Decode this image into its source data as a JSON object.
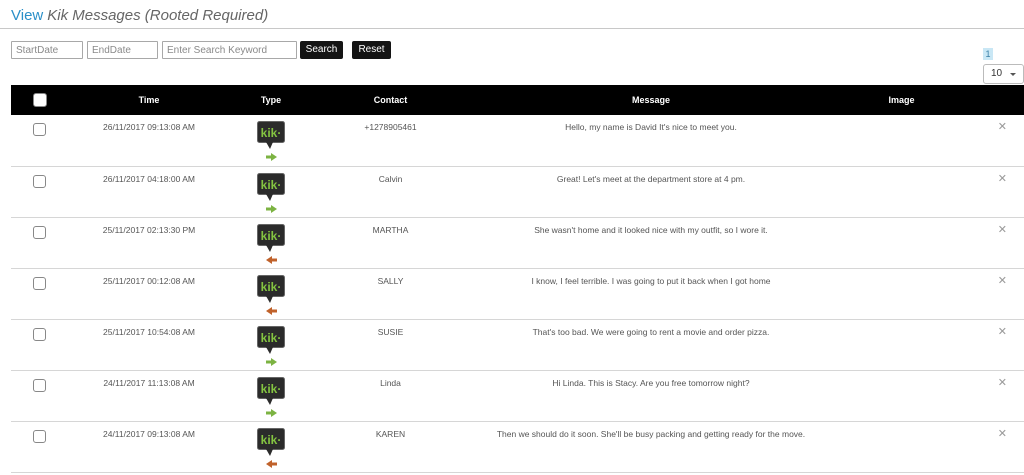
{
  "header": {
    "view_word": "View",
    "title": "Kik Messages (Rooted Required)"
  },
  "filters": {
    "start_placeholder": "StartDate",
    "end_placeholder": "EndDate",
    "keyword_placeholder": "Enter Search Keyword",
    "search_label": "Search",
    "reset_label": "Reset"
  },
  "pager": {
    "current_page": "1",
    "page_size": "10"
  },
  "table": {
    "columns": [
      "Time",
      "Type",
      "Contact",
      "Message",
      "Image"
    ],
    "rows": [
      {
        "time": "26/11/2017 09:13:08 AM",
        "direction": "outgoing",
        "contact": "+1278905461",
        "message": "Hello, my name is David It's nice to meet you."
      },
      {
        "time": "26/11/2017 04:18:00 AM",
        "direction": "outgoing",
        "contact": "Calvin",
        "message": "Great! Let's meet at the department store at 4 pm."
      },
      {
        "time": "25/11/2017 02:13:30 PM",
        "direction": "incoming",
        "contact": "MARTHA",
        "message": "She wasn't home and it looked nice with my outfit, so I wore it."
      },
      {
        "time": "25/11/2017 00:12:08 AM",
        "direction": "incoming",
        "contact": "SALLY",
        "message": "I know, I feel terrible. I was going to put it back when I got home"
      },
      {
        "time": "25/11/2017 10:54:08 AM",
        "direction": "outgoing",
        "contact": "SUSIE",
        "message": "That's too bad. We were going to rent a movie and order pizza."
      },
      {
        "time": "24/11/2017 11:13:08 AM",
        "direction": "outgoing",
        "contact": "Linda",
        "message": "Hi Linda. This is Stacy. Are you free tomorrow night?"
      },
      {
        "time": "24/11/2017 09:13:08 AM",
        "direction": "incoming",
        "contact": "KAREN",
        "message": "Then we should do it soon. She'll be busy packing and getting ready for the move."
      }
    ]
  },
  "icons": {
    "app_logo": "kik-logo-icon",
    "outgoing": "arrow-right-icon",
    "incoming": "arrow-left-icon",
    "delete": "close-icon"
  },
  "colors": {
    "link": "#2a8fc8",
    "header_bg": "#000000",
    "kik_bubble": "#2b2b2b",
    "kik_text": "#84c441",
    "outgoing_arrow": "#7cb342",
    "incoming_arrow": "#c0622b"
  },
  "labels": {
    "kik_text": "kik·",
    "delete_glyph": "✕"
  }
}
